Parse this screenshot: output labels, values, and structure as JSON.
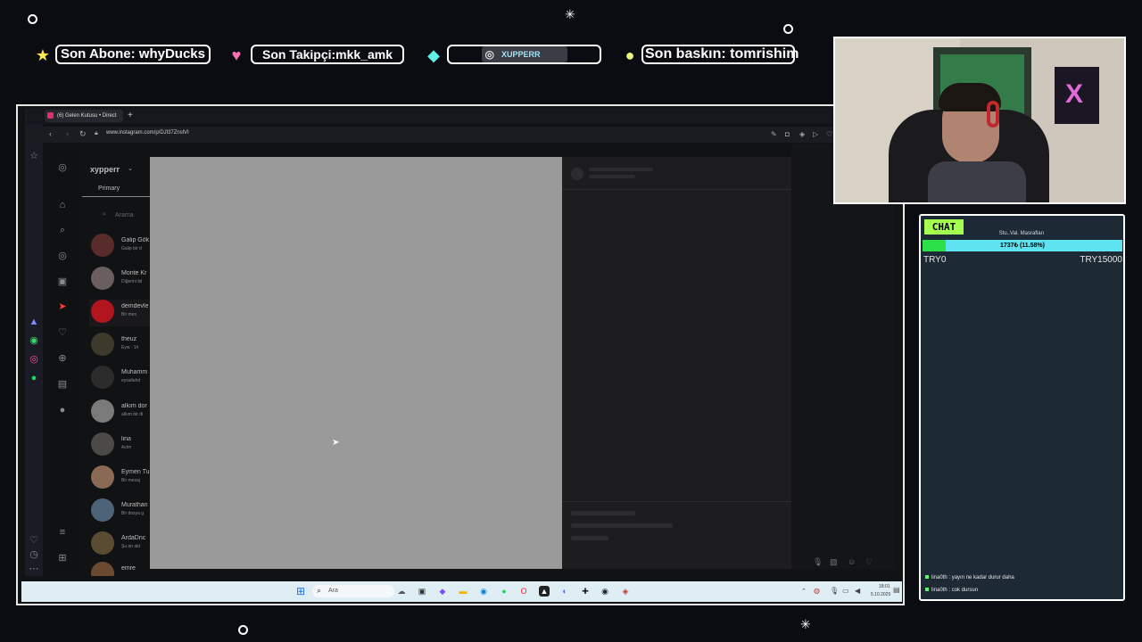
{
  "overlay": {
    "alerts": [
      {
        "icon": "star-icon",
        "text": "Son Abone: whyDucks"
      },
      {
        "icon": "heart-icon",
        "text": "Son Takipçi:mkk_amk"
      },
      {
        "icon": "diamond-icon",
        "text": "XUPPERR"
      },
      {
        "icon": "coin-icon",
        "text": "Son baskın: tomrishim"
      }
    ]
  },
  "browser": {
    "tab_title": "(6) Gelen Kutusu • Direct",
    "url": "www.instagram.com/p/DJl37ZnslVI"
  },
  "instagram": {
    "username": "xypperr",
    "primary_tab": "Primary",
    "search_placeholder": "Arama",
    "dm_list": [
      {
        "name": "Galip Gök",
        "sub": "Galip bir d"
      },
      {
        "name": "Monte Kr",
        "sub": "Diğerini bil"
      },
      {
        "name": "demdevle",
        "sub": "Bir mes"
      },
      {
        "name": "theuz",
        "sub": "Eyw · 1h"
      },
      {
        "name": "Muhamm",
        "sub": "eysallahd"
      },
      {
        "name": "alkım dor",
        "sub": "alkım bir di"
      },
      {
        "name": "lina",
        "sub": "Aclm"
      },
      {
        "name": "Eymen Tu",
        "sub": "Bir mesaj"
      },
      {
        "name": "Murathan",
        "sub": "Bir dosya g"
      },
      {
        "name": "ArdaDnc",
        "sub": "Şu an akt"
      },
      {
        "name": "emre",
        "sub": ""
      }
    ]
  },
  "taskbar": {
    "search_placeholder": "Ara",
    "time": "18:01",
    "date": "5.10.2025"
  },
  "chat": {
    "label": "CHAT",
    "goal_title": "Stu..Val. Masrafları",
    "goal_text": "1737₺ (11.58%)",
    "goal_progress": 0.1158,
    "goal_min": "TRY0",
    "goal_max": "TRY15000",
    "messages": [
      {
        "user": "lina0th",
        "text": "yayın ne kadar durur daha"
      },
      {
        "user": "lina0th",
        "text": "cok dursun"
      }
    ]
  },
  "colors": {
    "accent_green": "#a5ff4f",
    "goal_bar": "#5fe3f0",
    "modal_gray": "#9a9a9a"
  }
}
